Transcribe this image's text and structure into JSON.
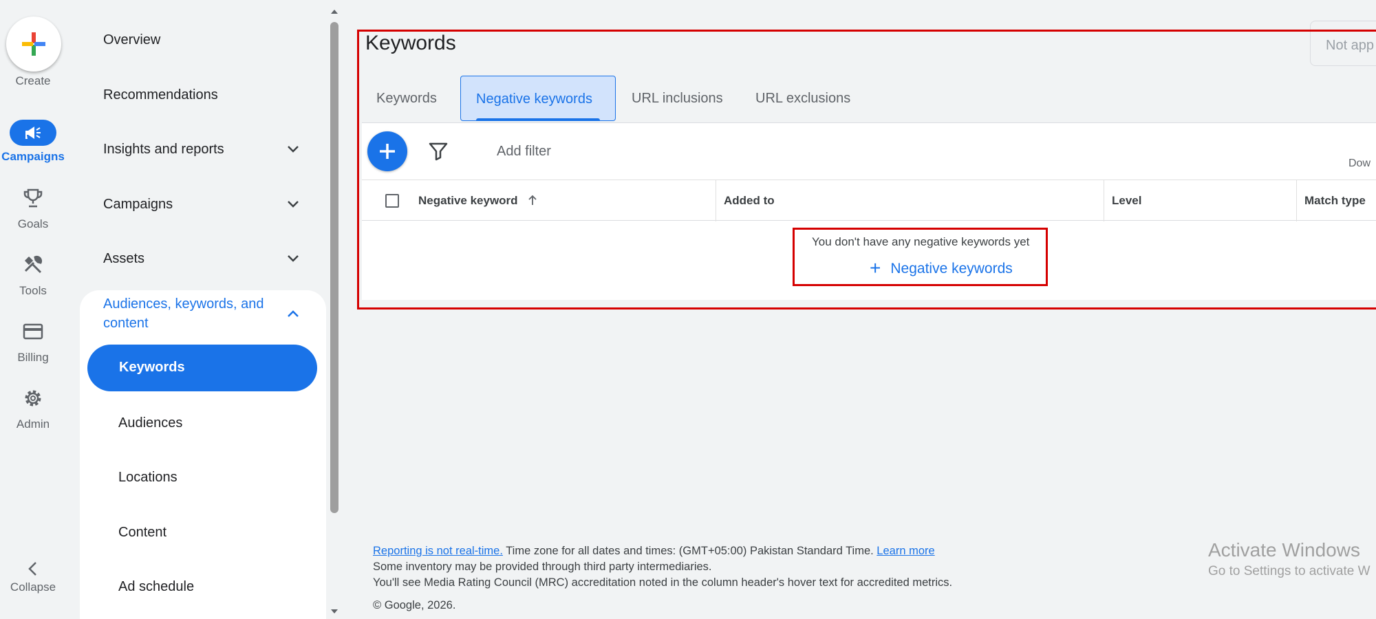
{
  "rail": {
    "create_label": "Create",
    "items": [
      {
        "label": "Campaigns",
        "icon": "campaigns-icon",
        "active": true
      },
      {
        "label": "Goals",
        "icon": "trophy-icon"
      },
      {
        "label": "Tools",
        "icon": "tools-icon"
      },
      {
        "label": "Billing",
        "icon": "credit-card-icon"
      },
      {
        "label": "Admin",
        "icon": "gear-icon"
      }
    ],
    "collapse_label": "Collapse"
  },
  "nav": {
    "items": [
      {
        "label": "Overview"
      },
      {
        "label": "Recommendations"
      },
      {
        "label": "Insights and reports"
      },
      {
        "label": "Campaigns"
      },
      {
        "label": "Assets"
      }
    ],
    "section_title": "Audiences, keywords, and content",
    "sub_items": [
      {
        "label": "Keywords",
        "active": true
      },
      {
        "label": "Audiences"
      },
      {
        "label": "Locations"
      },
      {
        "label": "Content"
      },
      {
        "label": "Ad schedule"
      }
    ]
  },
  "main": {
    "title": "Keywords",
    "not_applicable": "Not app",
    "tabs": [
      {
        "label": "Keywords"
      },
      {
        "label": "Negative keywords",
        "active": true
      },
      {
        "label": "URL inclusions"
      },
      {
        "label": "URL exclusions"
      }
    ],
    "toolbar": {
      "add_filter": "Add filter",
      "download_label": "Dow"
    },
    "table": {
      "columns": [
        "Negative keyword",
        "Added to",
        "Level",
        "Match type"
      ],
      "sort_column": "Negative keyword",
      "empty_message": "You don't have any negative keywords yet",
      "empty_action": "Negative keywords"
    }
  },
  "footer": {
    "link1": "Reporting is not real-time.",
    "line1_text": " Time zone for all dates and times: (GMT+05:00) Pakistan Standard Time. ",
    "link2": "Learn more",
    "line2": "Some inventory may be provided through third party intermediaries.",
    "line3": "You'll see Media Rating Council (MRC) accreditation noted in the column header's hover text for accredited metrics.",
    "copyright": "© Google, 2026."
  },
  "watermark": {
    "line1": "Activate Windows",
    "line2": "Go to Settings to activate W"
  },
  "colors": {
    "accent": "#1a73e8",
    "highlight_border": "#d50000",
    "active_tab_bg": "#d2e3fc"
  }
}
